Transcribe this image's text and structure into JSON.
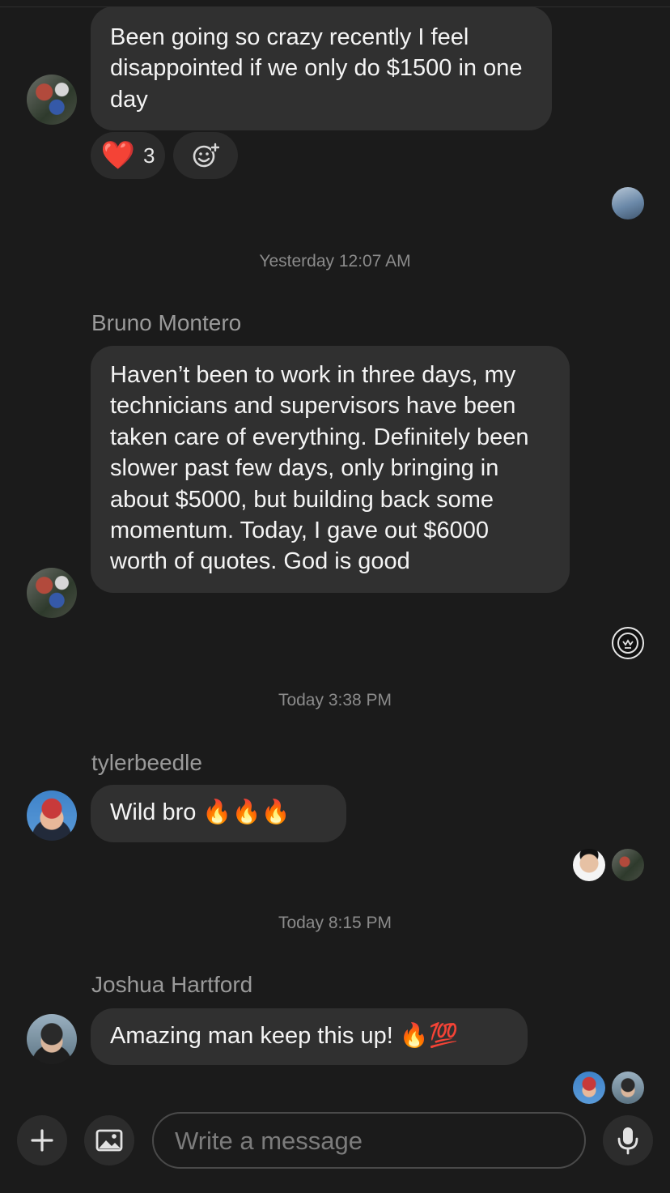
{
  "messages": [
    {
      "text": "Been going so crazy recently I feel disappointed if we only do $1500 in one day",
      "reaction": {
        "emoji": "❤️",
        "count": "3",
        "add_icon": "add-reaction-icon"
      }
    },
    {
      "timestamp": "Yesterday 12:07 AM",
      "sender": "Bruno Montero",
      "text": "Haven’t been to work in three days, my technicians and supervisors have been taken care of everything. Definitely been slower past few days, only bringing in about $5000, but building back some momentum. Today, I gave out $6000 worth of quotes. God is good"
    },
    {
      "timestamp": "Today 3:38 PM",
      "sender": "tylerbeedle",
      "text": "Wild bro 🔥🔥🔥"
    },
    {
      "timestamp": "Today 8:15 PM",
      "sender": "Joshua Hartford",
      "text": "Amazing man keep this up! 🔥💯"
    }
  ],
  "composer": {
    "placeholder": "Write a message",
    "add_icon": "plus-icon",
    "image_icon": "image-icon",
    "mic_icon": "microphone-icon"
  },
  "colors": {
    "background": "#1b1b1b",
    "bubble": "#303030",
    "heart": "#e62e2e"
  }
}
